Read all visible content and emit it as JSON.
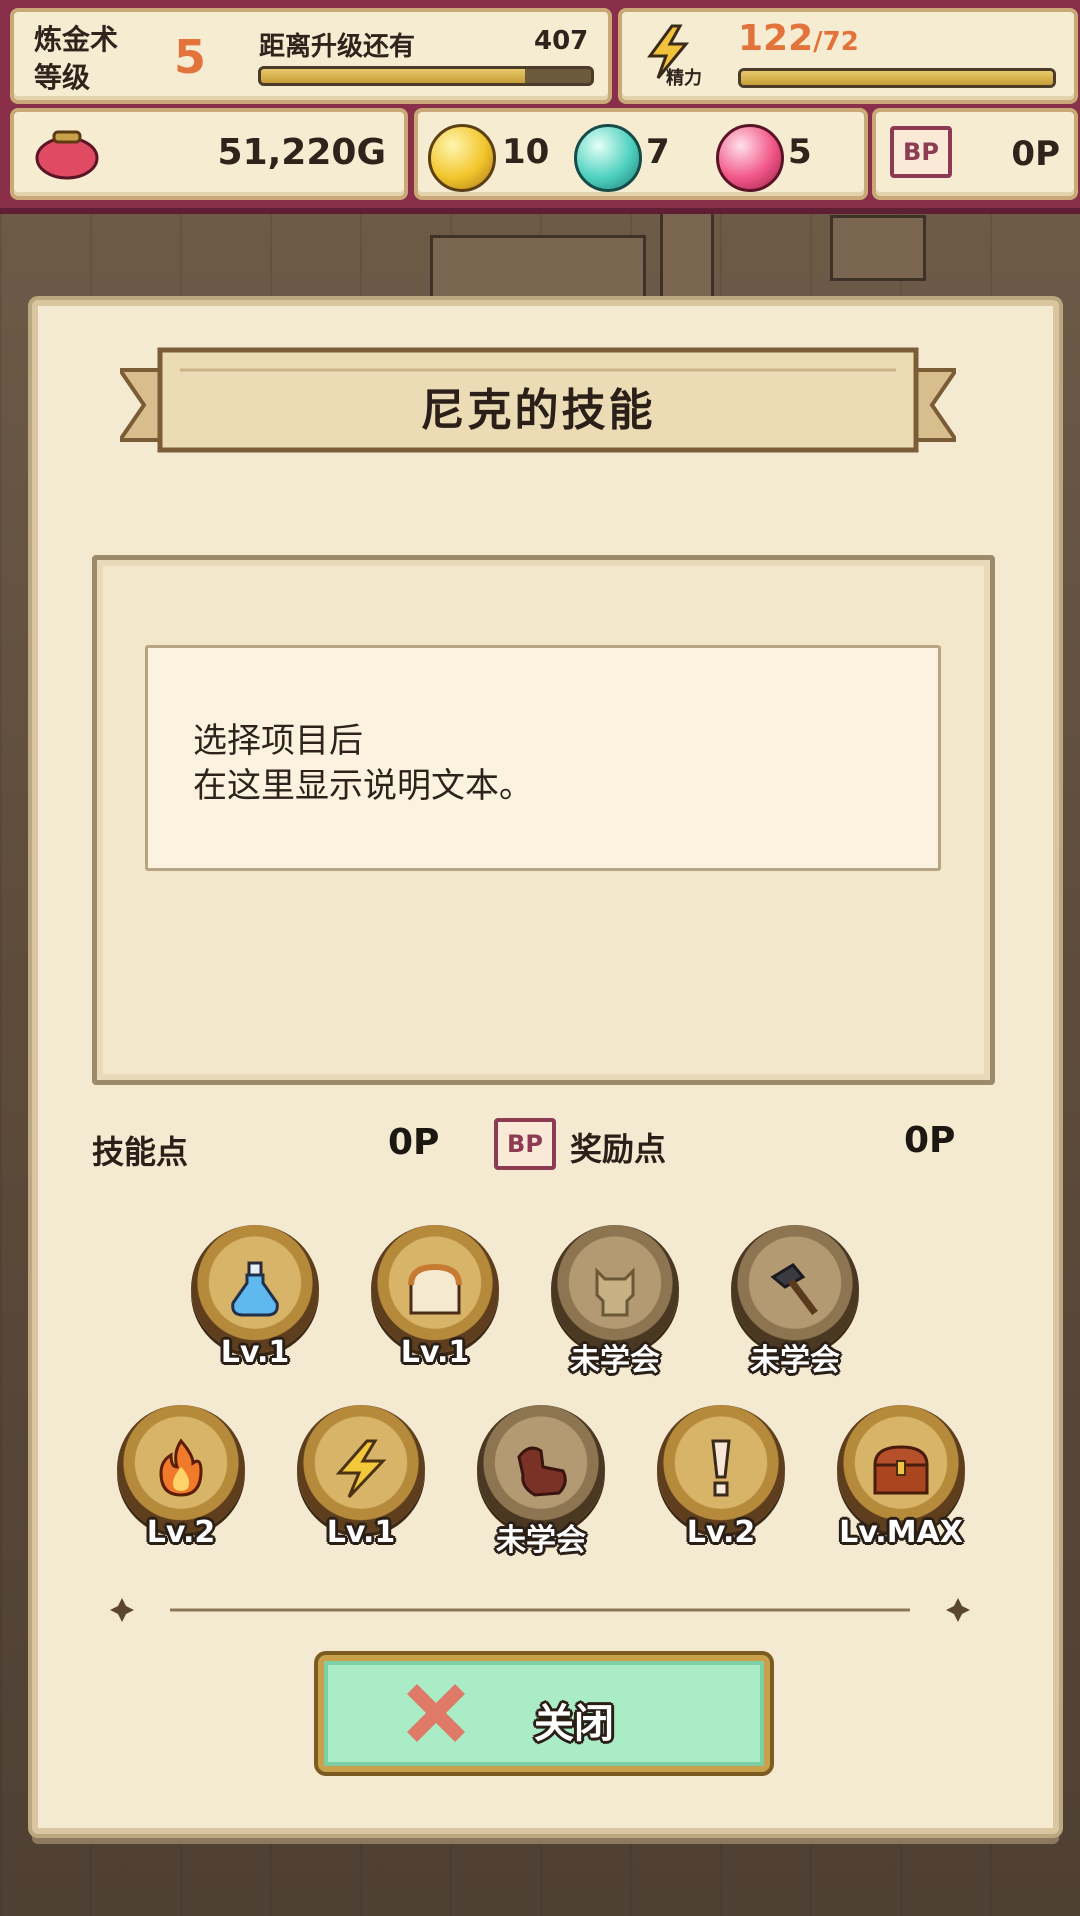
{
  "hud": {
    "alchemy_level_label_line1": "炼金术",
    "alchemy_level_label_line2": "等级",
    "alchemy_level": "5",
    "next_level_label": "距离升级还有",
    "next_level_value": "407",
    "next_level_progress": 0.8,
    "energy_label": "精力",
    "energy_current": "122",
    "energy_max": "/72",
    "energy_progress": 1.0,
    "gold": "51,220G",
    "gem_yellow": "10",
    "gem_teal": "7",
    "gem_pink": "5",
    "bp_badge": "BP",
    "bp_value": "0P"
  },
  "dialog": {
    "title": "尼克的技能",
    "description_line1": "选择项目后",
    "description_line2": "在这里显示说明文本。",
    "skill_points_label": "技能点",
    "skill_points_value": "0P",
    "bonus_badge": "BP",
    "bonus_points_label": "奖励点",
    "bonus_points_value": "0P",
    "close_label": "关闭"
  },
  "skills": [
    {
      "icon": "potion-icon",
      "level": "Lv.1",
      "learned": true
    },
    {
      "icon": "bread-icon",
      "level": "Lv.1",
      "learned": true
    },
    {
      "icon": "cat-icon",
      "level": "未学会",
      "learned": false
    },
    {
      "icon": "hammer-icon",
      "level": "未学会",
      "learned": false
    },
    {
      "icon": "flame-icon",
      "level": "Lv.2",
      "learned": true
    },
    {
      "icon": "lightning-icon",
      "level": "Lv.1",
      "learned": true
    },
    {
      "icon": "glove-icon",
      "level": "未学会",
      "learned": false
    },
    {
      "icon": "exclamation-icon",
      "level": "Lv.2",
      "learned": true
    },
    {
      "icon": "treasure-chest-icon",
      "level": "Lv.MAX",
      "learned": true
    }
  ],
  "colors": {
    "hud_bg": "#8a2f4a",
    "panel_bg": "#f6ecd2",
    "accent_orange": "#e2743b",
    "close_button": "#a9ecc6"
  }
}
